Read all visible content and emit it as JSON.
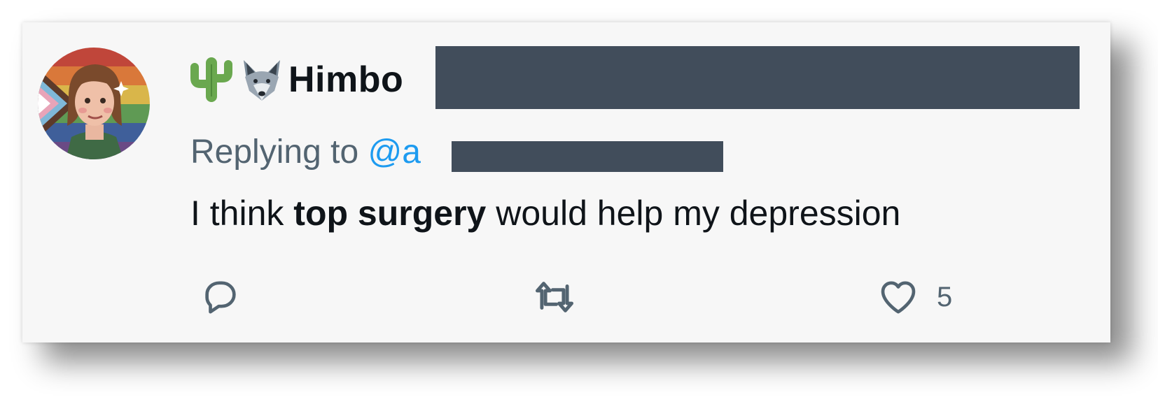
{
  "tweet": {
    "display_name": "Himbo",
    "emoji_icons": [
      "cactus-icon",
      "wolf-face-icon"
    ],
    "replying_prefix": "Replying to ",
    "replying_handle_visible": "@a",
    "text_before": "I think ",
    "text_bold": "top surgery",
    "text_after": " would help my depression"
  },
  "actions": {
    "reply_icon": "reply-bubble-icon",
    "retweet_icon": "retweet-icon",
    "like_icon": "heart-icon",
    "like_count": "5"
  },
  "colors": {
    "name": "#0f1419",
    "secondary": "#536471",
    "link": "#1d9bf0",
    "redaction": "#414d5b",
    "card_bg": "#f7f7f7"
  }
}
